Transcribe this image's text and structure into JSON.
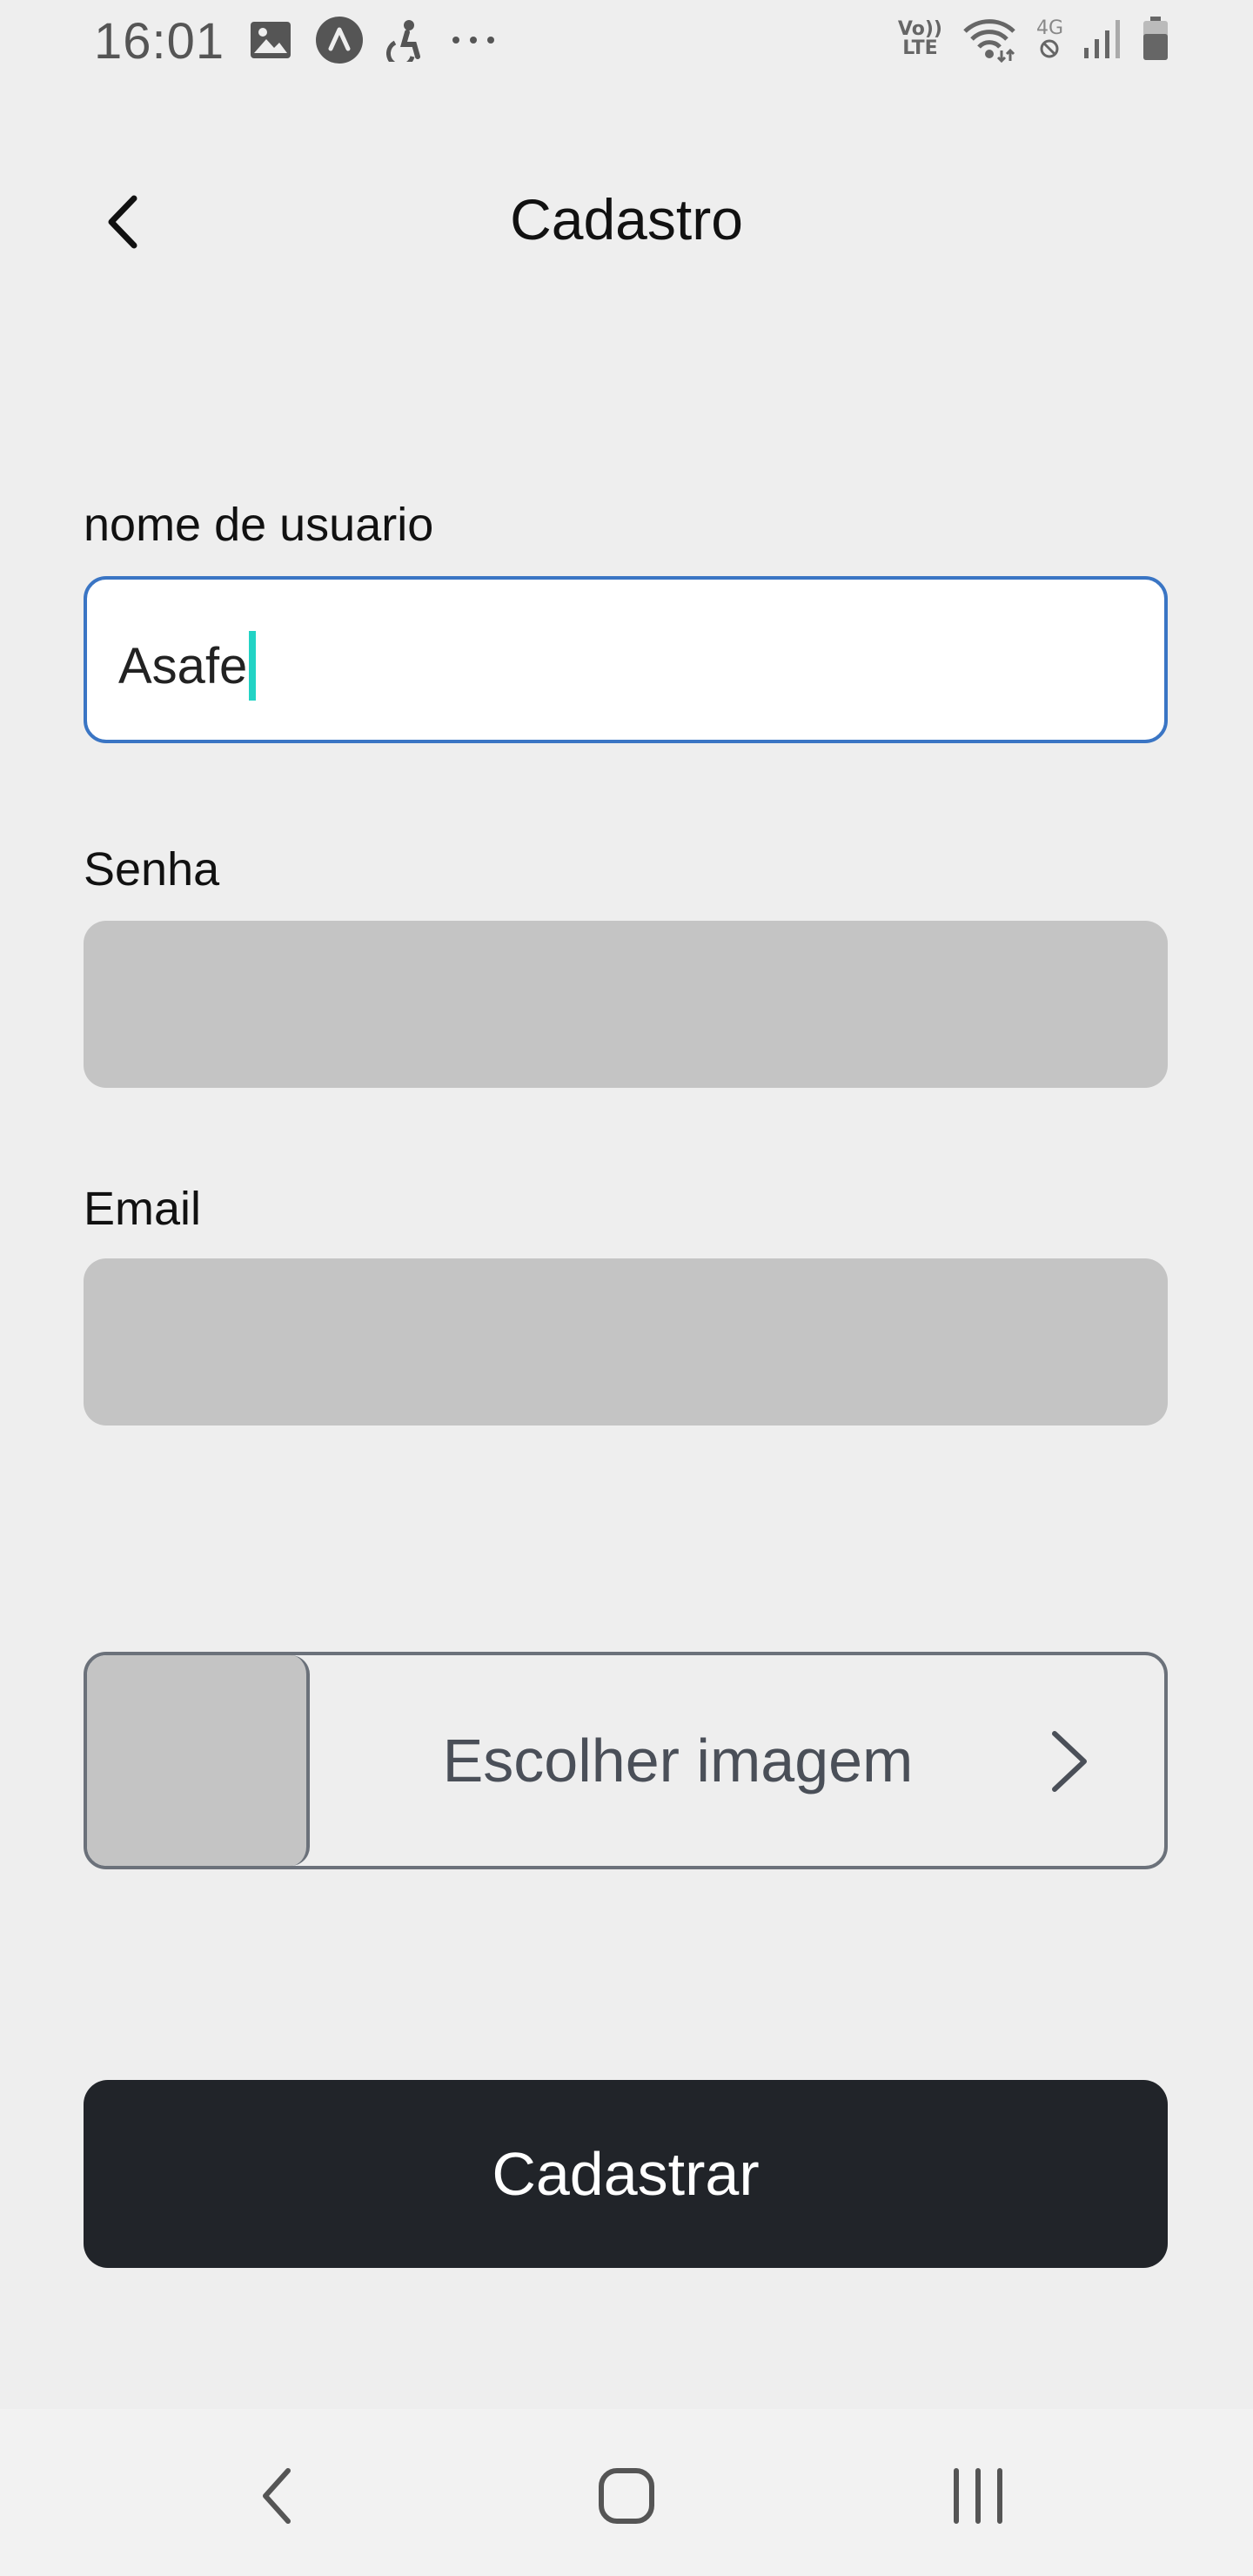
{
  "status_bar": {
    "time": "16:01",
    "left_icons": [
      "image-icon",
      "app-launcher-icon",
      "accessibility-icon",
      "more-dots-icon"
    ],
    "right_icons": [
      "volte-icon",
      "wifi-icon",
      "4g-icon",
      "signal-icon",
      "battery-icon"
    ],
    "volte_top": "Vo))",
    "volte_bottom": "LTE",
    "network_label": "4G"
  },
  "header": {
    "title": "Cadastro",
    "back_icon": "chevron-left-icon"
  },
  "form": {
    "username": {
      "label": "nome de usuario",
      "value": "Asafe"
    },
    "password": {
      "label": "Senha",
      "value": ""
    },
    "email": {
      "label": "Email",
      "value": ""
    },
    "image_picker": {
      "label": "Escolher imagem",
      "icon": "chevron-right-icon"
    },
    "submit_label": "Cadastrar"
  },
  "nav_bar": {
    "items": [
      "back-nav-icon",
      "home-nav-icon",
      "recents-nav-icon"
    ]
  },
  "colors": {
    "background": "#eeeeee",
    "focus_border": "#3a75c4",
    "caret": "#22d3c5",
    "disabled_field": "#c4c4c4",
    "button": "#212429"
  }
}
